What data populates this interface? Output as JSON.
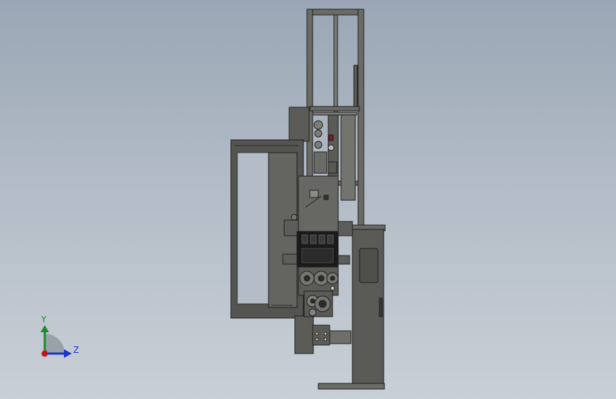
{
  "axes": {
    "y_label": "Y",
    "z_label": "Z",
    "y_color": "#1a8a2e",
    "z_color": "#1b35c9",
    "origin_color": "#c41515"
  },
  "colors": {
    "metal_dark": "#4e4e4a",
    "metal_mid": "#686864",
    "metal_light": "#8c8c88",
    "edge": "#1e1e1c",
    "panel_black": "#1b1b1b"
  }
}
